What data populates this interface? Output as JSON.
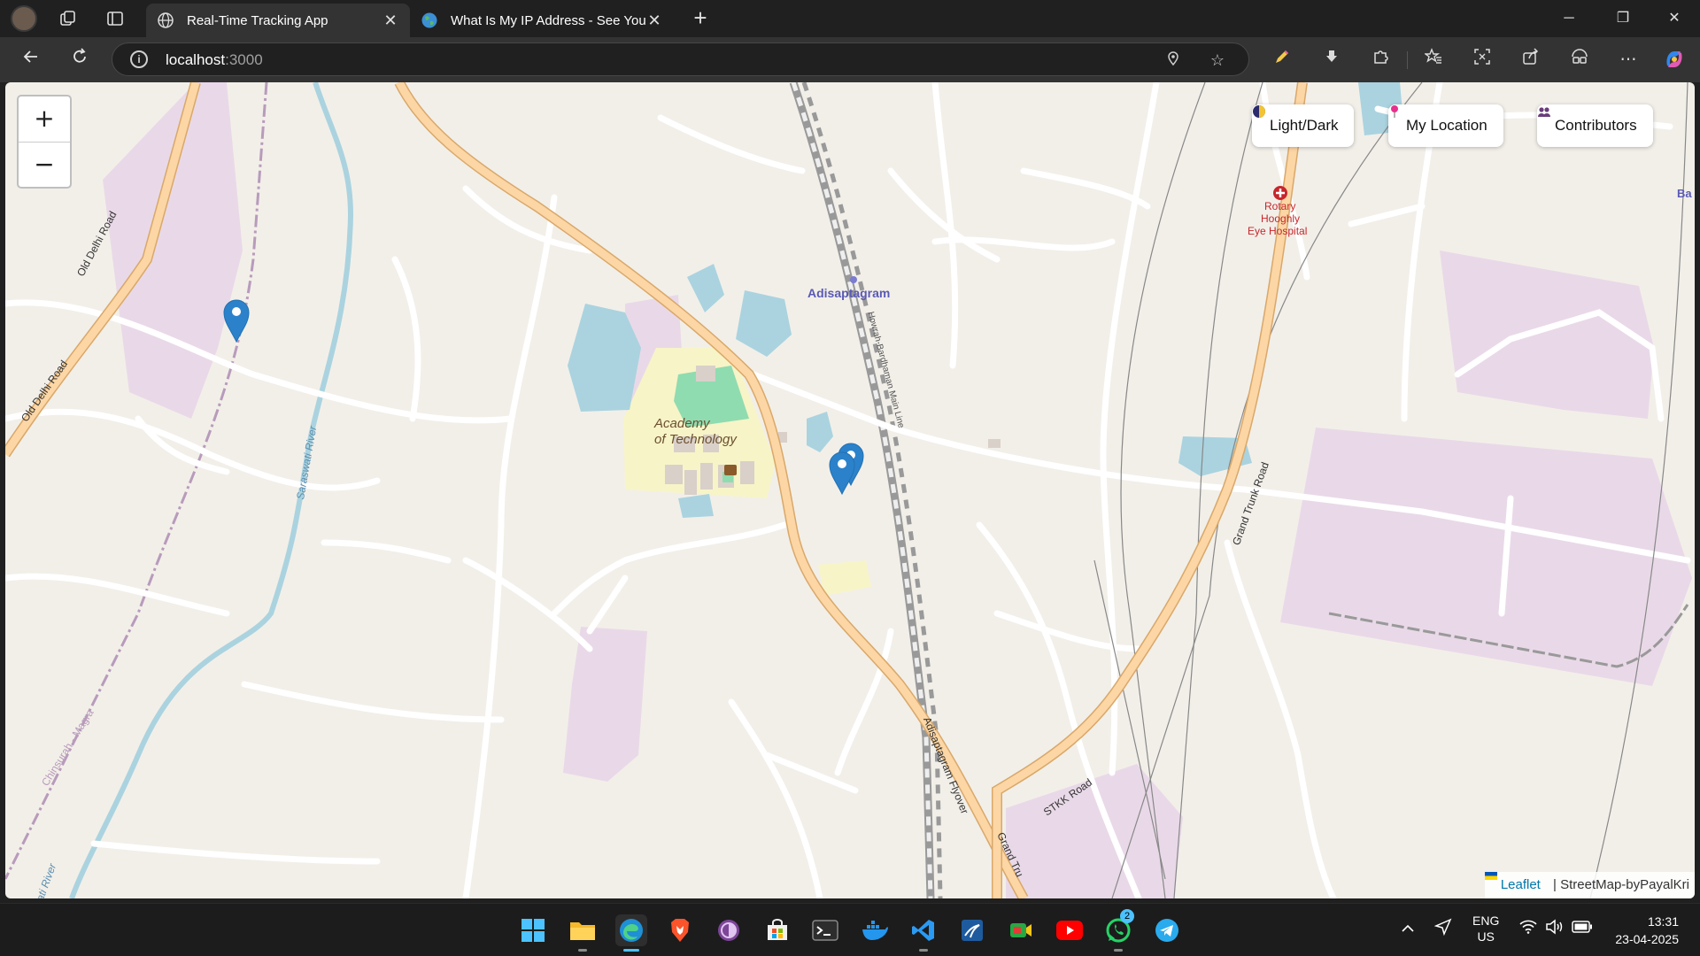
{
  "browser": {
    "tabs": [
      {
        "title": "Real-Time Tracking App",
        "active": true
      },
      {
        "title": "What Is My IP Address - See Your",
        "active": false
      }
    ],
    "address": {
      "host": "localhost",
      "port": ":3000"
    },
    "icons": [
      "profile-avatar",
      "workspaces-icon",
      "vertical-tabs-icon",
      "back-icon",
      "refresh-icon",
      "info-icon",
      "location-icon",
      "favorite-star-icon",
      "pen-extension-icon",
      "download-icon",
      "extensions-icon",
      "favorites-icon",
      "screenshot-icon",
      "share-icon",
      "browser-essentials-icon",
      "more-icon",
      "copilot-icon"
    ]
  },
  "map": {
    "controls": {
      "zoom_in": "+",
      "zoom_out": "−"
    },
    "buttons": [
      {
        "label": "Light/Dark",
        "icon": "half-moon-icon"
      },
      {
        "label": "My Location",
        "icon": "pin-icon"
      },
      {
        "label": "Contributors",
        "icon": "people-icon"
      }
    ],
    "labels": {
      "academy_1": "Academy",
      "academy_2": "of Technology",
      "adisaptagram": "Adisaptagram",
      "hospital_1": "Rotary",
      "hospital_2": "Hooghly",
      "hospital_3": "Eye Hospital",
      "old_delhi_1": "Old Delhi Road",
      "old_delhi_2": "Old Delhi Road",
      "saraswati": "Saraswati River",
      "saraswati_2": "ati River",
      "chinsurah": "Chinsurah - Magra",
      "grand_trunk": "Grand Trunk Road",
      "grand_trunk_2": "Grand Tru",
      "stkk": "STKK Road",
      "flyover": "Adisaptagram Flyover",
      "railway": "Howrah-Bardhaman Main Line",
      "edge_label": "Ba"
    },
    "markers": 3,
    "attribution": {
      "leaflet": "Leaflet",
      "rest": "| StreetMap-byPayalKri"
    }
  },
  "taskbar": {
    "apps": [
      "windows-start-icon",
      "file-explorer-icon",
      "edge-icon",
      "brave-icon",
      "tor-icon",
      "store-icon",
      "terminal-icon",
      "docker-icon",
      "vscode-icon",
      "wireshark-icon",
      "camo-icon",
      "youtube-icon",
      "whatsapp-icon",
      "telegram-icon"
    ],
    "whatsapp_badge": "2",
    "lang_1": "ENG",
    "lang_2": "US",
    "time": "13:31",
    "date": "23-04-2025"
  }
}
